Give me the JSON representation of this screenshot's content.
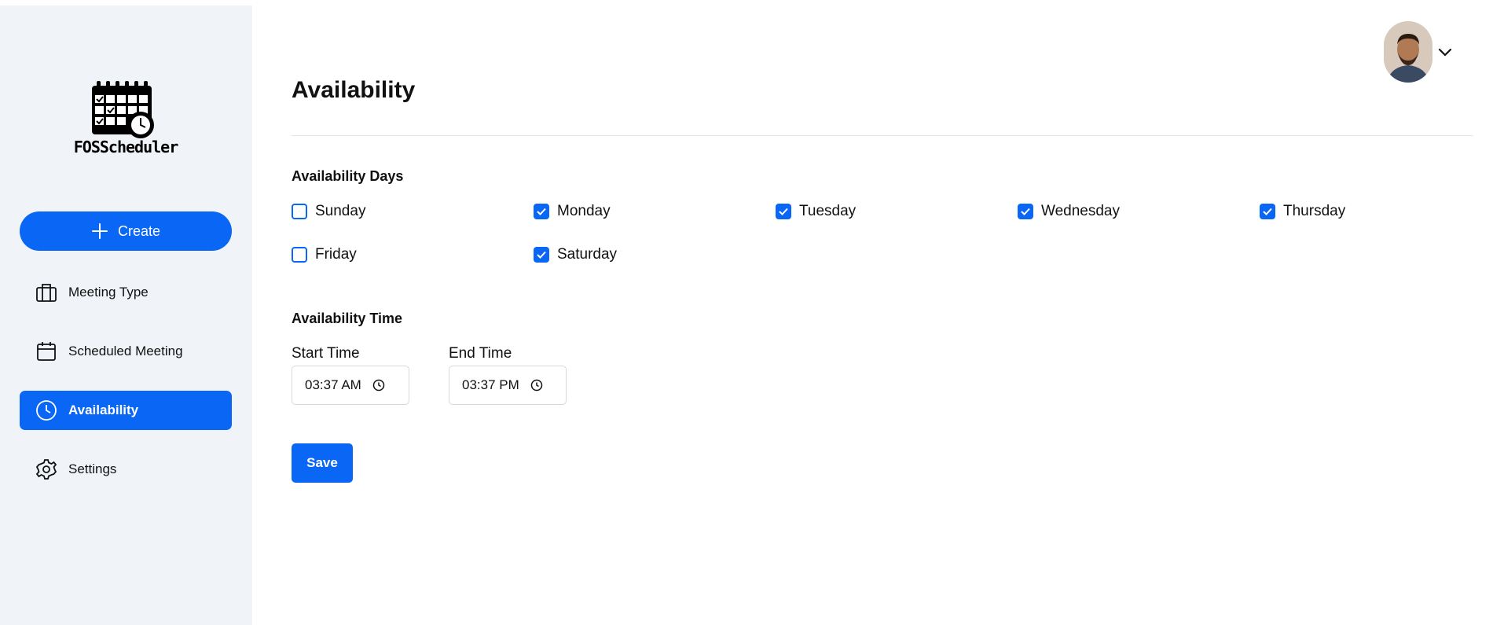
{
  "app": {
    "logo_text": "FOSScheduler"
  },
  "sidebar": {
    "create_label": "Create",
    "items": [
      {
        "label": "Meeting Type",
        "icon": "briefcase-icon",
        "active": false
      },
      {
        "label": "Scheduled Meeting",
        "icon": "calendar-icon",
        "active": false
      },
      {
        "label": "Availability",
        "icon": "clock-icon",
        "active": true
      },
      {
        "label": "Settings",
        "icon": "gear-icon",
        "active": false
      }
    ]
  },
  "header": {
    "avatar": "user-avatar",
    "menu_icon": "chevron-down-icon"
  },
  "main": {
    "title": "Availability",
    "days_section": {
      "title": "Availability Days",
      "days": [
        {
          "label": "Sunday",
          "checked": false
        },
        {
          "label": "Monday",
          "checked": true
        },
        {
          "label": "Tuesday",
          "checked": true
        },
        {
          "label": "Wednesday",
          "checked": true
        },
        {
          "label": "Thursday",
          "checked": true
        },
        {
          "label": "Friday",
          "checked": false
        },
        {
          "label": "Saturday",
          "checked": true
        }
      ]
    },
    "time_section": {
      "title": "Availability Time",
      "start": {
        "label": "Start Time",
        "value": "03:37 AM"
      },
      "end": {
        "label": "End Time",
        "value": "03:37 PM"
      }
    },
    "save_label": "Save"
  },
  "colors": {
    "accent": "#0a66f5",
    "sidebar_bg": "#f0f3f8"
  }
}
